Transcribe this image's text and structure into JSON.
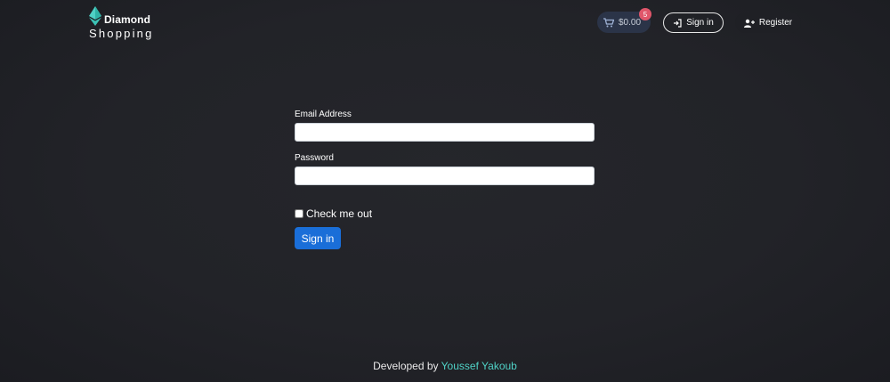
{
  "brand": {
    "name": "Diamond",
    "subtitle": "Shopping",
    "icon": "diamond-icon"
  },
  "header": {
    "cart": {
      "icon": "cart-icon",
      "amount": "$0.00",
      "badge_count": "5"
    },
    "signin": {
      "icon": "sign-in-icon",
      "label": "Sign in"
    },
    "register": {
      "icon": "user-plus-icon",
      "label": "Register"
    }
  },
  "form": {
    "email_label": "Email Address",
    "email_value": "",
    "password_label": "Password",
    "password_value": "",
    "checkbox_label": "Check me out",
    "checkbox_checked": false,
    "submit_label": "Sign in"
  },
  "footer": {
    "prefix": "Developed by",
    "author": "Youssef Yakoub"
  },
  "colors": {
    "background": "#222328",
    "accent": "#4fd1c5",
    "primary_button": "#1a6ed8",
    "badge": "#e0566a"
  }
}
